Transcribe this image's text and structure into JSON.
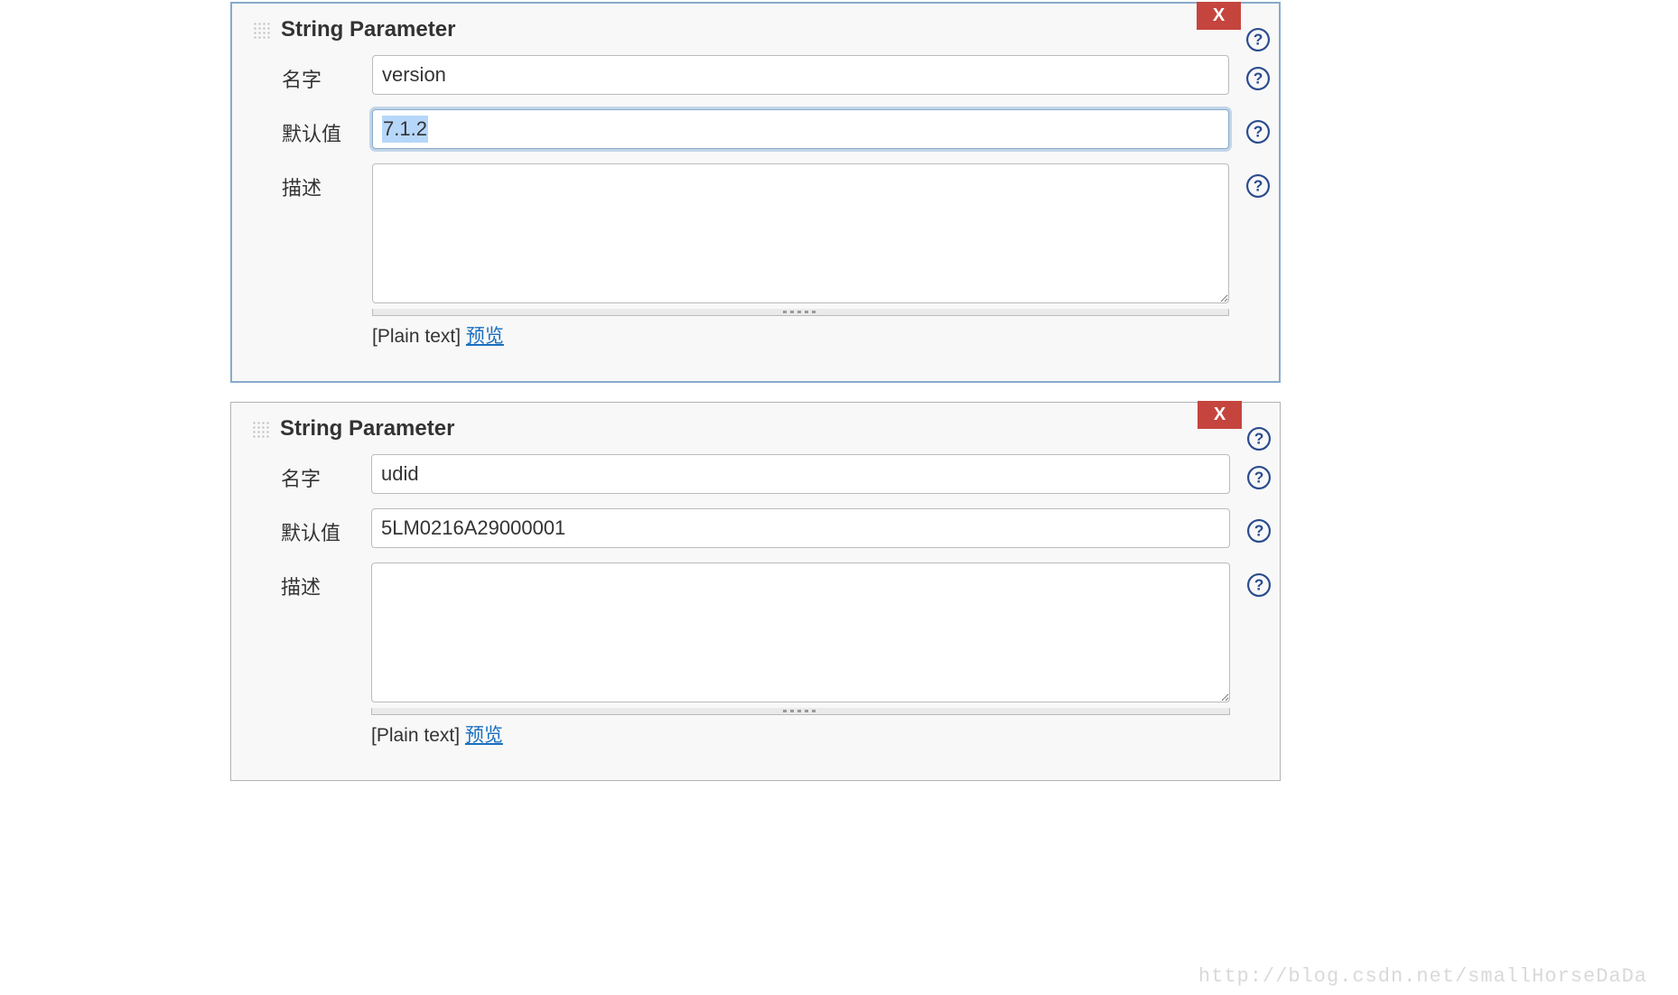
{
  "delete_label": "X",
  "parameters": [
    {
      "title": "String Parameter",
      "focused": true,
      "name_label": "名字",
      "name_value": "version",
      "default_label": "默认值",
      "default_value": "7.1.2",
      "default_focused": true,
      "desc_label": "描述",
      "desc_value": "",
      "plain_text_label": "[Plain text]",
      "preview_label": "预览"
    },
    {
      "title": "String Parameter",
      "focused": false,
      "name_label": "名字",
      "name_value": "udid",
      "default_label": "默认值",
      "default_value": "5LM0216A29000001",
      "default_focused": false,
      "desc_label": "描述",
      "desc_value": "",
      "plain_text_label": "[Plain text]",
      "preview_label": "预览"
    }
  ],
  "watermark": "http://blog.csdn.net/smallHorseDaDa"
}
